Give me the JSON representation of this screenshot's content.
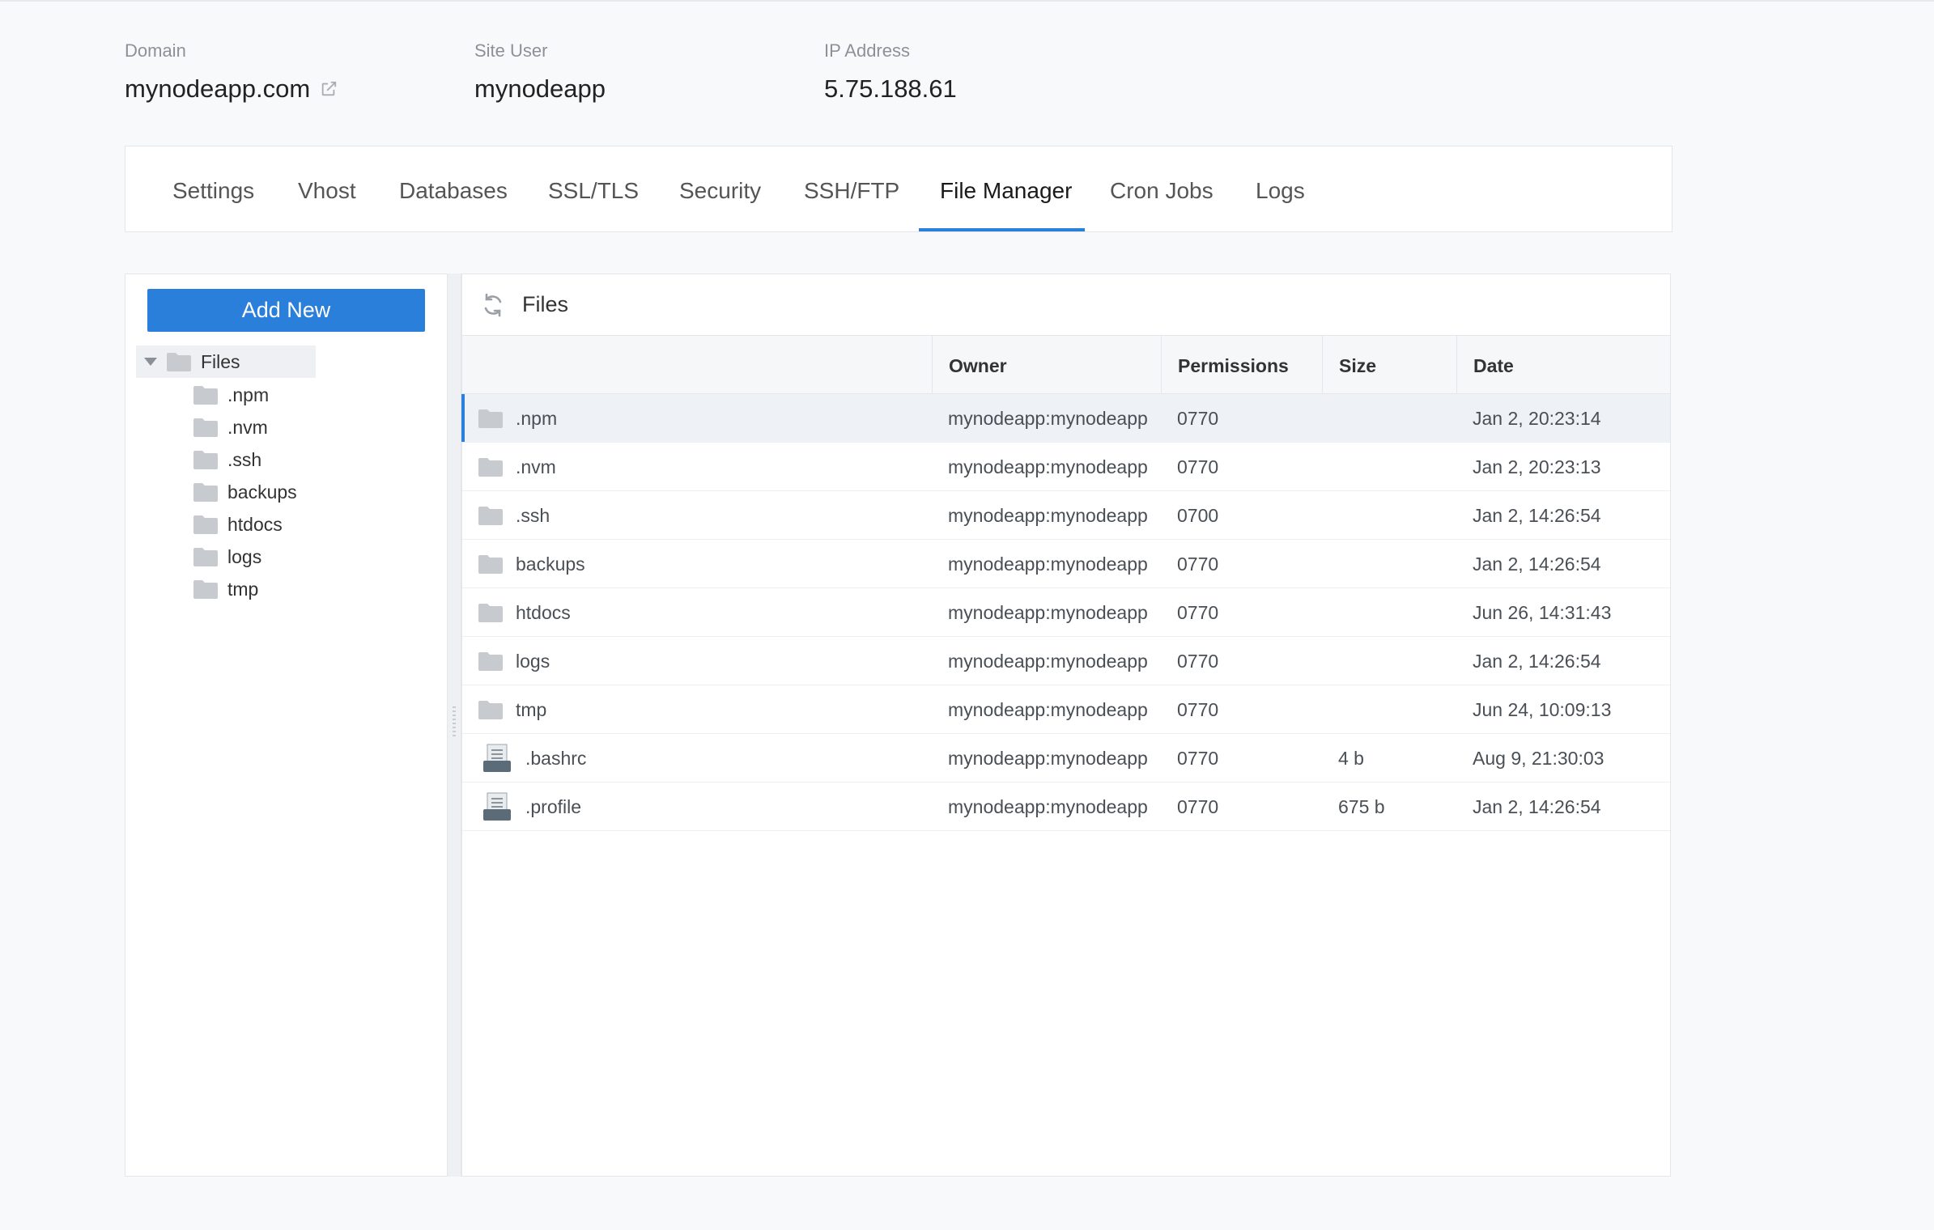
{
  "header": {
    "domain_label": "Domain",
    "domain_value": "mynodeapp.com",
    "site_user_label": "Site User",
    "site_user_value": "mynodeapp",
    "ip_label": "IP Address",
    "ip_value": "5.75.188.61"
  },
  "tabs": [
    {
      "label": "Settings"
    },
    {
      "label": "Vhost"
    },
    {
      "label": "Databases"
    },
    {
      "label": "SSL/TLS"
    },
    {
      "label": "Security"
    },
    {
      "label": "SSH/FTP"
    },
    {
      "label": "File Manager",
      "active": true
    },
    {
      "label": "Cron Jobs"
    },
    {
      "label": "Logs"
    }
  ],
  "sidebar": {
    "add_new_label": "Add New",
    "root_label": "Files",
    "children": [
      ".npm",
      ".nvm",
      ".ssh",
      "backups",
      "htdocs",
      "logs",
      "tmp"
    ]
  },
  "files_panel": {
    "title": "Files",
    "columns": [
      "",
      "Owner",
      "Permissions",
      "Size",
      "Date"
    ],
    "rows": [
      {
        "name": ".npm",
        "type": "folder",
        "owner": "mynodeapp:mynodeapp",
        "permissions": "0770",
        "size": "",
        "date": "Jan 2, 20:23:14",
        "selected": true
      },
      {
        "name": ".nvm",
        "type": "folder",
        "owner": "mynodeapp:mynodeapp",
        "permissions": "0770",
        "size": "",
        "date": "Jan 2, 20:23:13"
      },
      {
        "name": ".ssh",
        "type": "folder",
        "owner": "mynodeapp:mynodeapp",
        "permissions": "0700",
        "size": "",
        "date": "Jan 2, 14:26:54"
      },
      {
        "name": "backups",
        "type": "folder",
        "owner": "mynodeapp:mynodeapp",
        "permissions": "0770",
        "size": "",
        "date": "Jan 2, 14:26:54"
      },
      {
        "name": "htdocs",
        "type": "folder",
        "owner": "mynodeapp:mynodeapp",
        "permissions": "0770",
        "size": "",
        "date": "Jun 26, 14:31:43"
      },
      {
        "name": "logs",
        "type": "folder",
        "owner": "mynodeapp:mynodeapp",
        "permissions": "0770",
        "size": "",
        "date": "Jan 2, 14:26:54"
      },
      {
        "name": "tmp",
        "type": "folder",
        "owner": "mynodeapp:mynodeapp",
        "permissions": "0770",
        "size": "",
        "date": "Jun 24, 10:09:13"
      },
      {
        "name": ".bashrc",
        "type": "file",
        "owner": "mynodeapp:mynodeapp",
        "permissions": "0770",
        "size": "4 b",
        "date": "Aug 9, 21:30:03"
      },
      {
        "name": ".profile",
        "type": "file",
        "owner": "mynodeapp:mynodeapp",
        "permissions": "0770",
        "size": "675 b",
        "date": "Jan 2, 14:26:54"
      }
    ]
  },
  "colors": {
    "accent": "#2a7fdb",
    "folder": "#c7cacf",
    "file": "#5c6b78"
  },
  "icons": {
    "external_link": "external-link-icon",
    "refresh": "refresh-icon",
    "folder": "folder-icon",
    "file": "file-icon",
    "caret": "caret-down-icon"
  }
}
